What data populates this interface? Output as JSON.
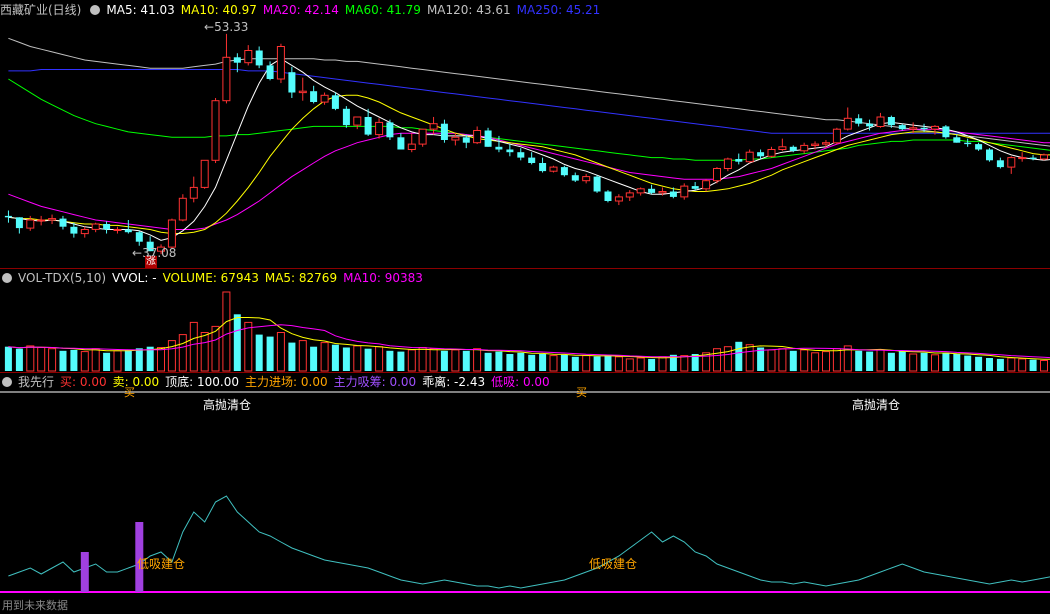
{
  "colors": {
    "up": "#ff3232",
    "down": "#54fcfc",
    "ma5": "#ffffff",
    "ma10": "#ffff00",
    "ma20": "#ff00ff",
    "ma60": "#00ff00",
    "ma120": "#c0c0c0",
    "ma250": "#3232ff",
    "grid": "#8b0000"
  },
  "price_panel": {
    "title": "西藏矿业(日线)",
    "items": [
      {
        "label": "MA5: 41.03",
        "color": "#ffffff"
      },
      {
        "label": "MA10: 40.97",
        "color": "#ffff00"
      },
      {
        "label": "MA20: 42.14",
        "color": "#ff00ff"
      },
      {
        "label": "MA60: 41.79",
        "color": "#00ff00"
      },
      {
        "label": "MA120: 43.61",
        "color": "#c0c0c0"
      },
      {
        "label": "MA250: 45.21",
        "color": "#3232ff"
      }
    ],
    "high_label": "53.33",
    "low_label": "37.08",
    "marker": "涨"
  },
  "volume_panel": {
    "title": "VOL-TDX(5,10)",
    "items": [
      {
        "label": "VVOL: -",
        "color": "#ffffff"
      },
      {
        "label": "VOLUME: 67943",
        "color": "#ffff00"
      },
      {
        "label": "MA5: 82769",
        "color": "#ffff00"
      },
      {
        "label": "MA10: 90383",
        "color": "#ff00ff"
      }
    ]
  },
  "indicator_panel": {
    "title": "我先行",
    "items": [
      {
        "label": "买: 0.00",
        "color": "#ff3232"
      },
      {
        "label": "卖: 0.00",
        "color": "#ffff00"
      },
      {
        "label": "顶底: 100.00",
        "color": "#ffffff"
      },
      {
        "label": "主力进场: 0.00",
        "color": "#ffa500"
      },
      {
        "label": "主力吸筹: 0.00",
        "color": "#a050ff"
      },
      {
        "label": "乖离: -2.43",
        "color": "#ffffff"
      },
      {
        "label": "低吸: 0.00",
        "color": "#ff00ff"
      }
    ],
    "signal_sell": "高抛清仓",
    "signal_buy": "低吸建仓",
    "buy_mark": "买",
    "watermark": "用到未来数据"
  },
  "chart_data": {
    "type": "candlestick",
    "candles": [
      [
        39.9,
        40.3,
        39.4,
        39.8
      ],
      [
        39.8,
        39.8,
        38.6,
        39.0
      ],
      [
        39.0,
        39.9,
        38.8,
        39.6
      ],
      [
        39.6,
        39.9,
        39.2,
        39.6
      ],
      [
        39.6,
        40.0,
        39.3,
        39.7
      ],
      [
        39.7,
        39.9,
        38.9,
        39.1
      ],
      [
        39.1,
        39.4,
        38.3,
        38.6
      ],
      [
        38.6,
        39.1,
        38.3,
        38.9
      ],
      [
        38.9,
        39.4,
        38.7,
        39.3
      ],
      [
        39.3,
        39.5,
        38.6,
        38.9
      ],
      [
        38.9,
        39.1,
        38.6,
        38.9
      ],
      [
        38.9,
        39.6,
        38.6,
        38.7
      ],
      [
        38.7,
        38.8,
        37.7,
        38.0
      ],
      [
        38.0,
        38.4,
        37.3,
        37.3
      ],
      [
        37.3,
        37.8,
        37.08,
        37.6
      ],
      [
        37.6,
        39.7,
        37.5,
        39.6
      ],
      [
        39.6,
        41.5,
        39.5,
        41.2
      ],
      [
        41.2,
        42.8,
        40.9,
        42.0
      ],
      [
        42.0,
        44.0,
        41.9,
        44.0
      ],
      [
        44.0,
        48.6,
        43.8,
        48.4
      ],
      [
        48.4,
        53.33,
        48.2,
        51.6
      ],
      [
        51.6,
        51.9,
        50.5,
        51.2
      ],
      [
        51.2,
        52.5,
        51.0,
        52.1
      ],
      [
        52.1,
        52.4,
        50.8,
        51.0
      ],
      [
        51.0,
        51.3,
        49.9,
        50.0
      ],
      [
        50.0,
        52.6,
        49.7,
        52.4
      ],
      [
        50.5,
        50.9,
        48.6,
        49.0
      ],
      [
        49.0,
        50.1,
        48.4,
        49.1
      ],
      [
        49.1,
        49.5,
        48.2,
        48.3
      ],
      [
        48.3,
        49.0,
        48.1,
        48.8
      ],
      [
        48.8,
        49.0,
        47.7,
        47.8
      ],
      [
        47.8,
        48.0,
        46.4,
        46.6
      ],
      [
        46.6,
        47.2,
        46.3,
        47.2
      ],
      [
        47.2,
        47.8,
        45.8,
        45.9
      ],
      [
        45.9,
        47.1,
        45.6,
        46.8
      ],
      [
        46.8,
        47.0,
        45.5,
        45.7
      ],
      [
        45.7,
        46.0,
        44.8,
        44.8
      ],
      [
        44.8,
        46.0,
        44.6,
        45.2
      ],
      [
        45.2,
        46.3,
        45.0,
        46.3
      ],
      [
        46.3,
        47.2,
        45.9,
        46.7
      ],
      [
        46.7,
        47.0,
        45.3,
        45.5
      ],
      [
        45.5,
        46.0,
        45.1,
        45.7
      ],
      [
        45.7,
        45.9,
        44.9,
        45.3
      ],
      [
        45.3,
        46.5,
        45.2,
        46.2
      ],
      [
        46.2,
        46.4,
        45.0,
        45.0
      ],
      [
        45.0,
        45.8,
        44.6,
        44.8
      ],
      [
        44.8,
        45.2,
        44.3,
        44.6
      ],
      [
        44.6,
        44.9,
        44.0,
        44.2
      ],
      [
        44.2,
        44.6,
        43.7,
        43.8
      ],
      [
        43.8,
        44.2,
        43.1,
        43.2
      ],
      [
        43.2,
        43.6,
        43.1,
        43.5
      ],
      [
        43.5,
        43.6,
        42.8,
        42.9
      ],
      [
        42.9,
        43.1,
        42.4,
        42.5
      ],
      [
        42.5,
        43.0,
        42.3,
        42.8
      ],
      [
        42.8,
        42.9,
        41.6,
        41.7
      ],
      [
        41.7,
        41.8,
        40.9,
        41.0
      ],
      [
        41.0,
        41.5,
        40.7,
        41.3
      ],
      [
        41.3,
        41.8,
        41.0,
        41.6
      ],
      [
        41.6,
        42.0,
        41.4,
        41.9
      ],
      [
        41.9,
        42.2,
        41.5,
        41.6
      ],
      [
        41.6,
        42.0,
        41.4,
        41.7
      ],
      [
        41.7,
        42.0,
        41.2,
        41.3
      ],
      [
        41.3,
        42.3,
        41.1,
        42.1
      ],
      [
        42.1,
        42.4,
        41.8,
        41.9
      ],
      [
        41.9,
        42.6,
        41.7,
        42.5
      ],
      [
        42.5,
        43.5,
        42.3,
        43.4
      ],
      [
        43.4,
        44.2,
        43.2,
        44.1
      ],
      [
        44.1,
        44.5,
        43.7,
        43.9
      ],
      [
        43.9,
        44.8,
        43.8,
        44.6
      ],
      [
        44.6,
        44.8,
        44.1,
        44.3
      ],
      [
        44.3,
        45.0,
        44.2,
        44.8
      ],
      [
        44.8,
        45.6,
        44.7,
        45.0
      ],
      [
        45.0,
        45.1,
        44.6,
        44.7
      ],
      [
        44.7,
        45.3,
        44.5,
        45.1
      ],
      [
        45.1,
        45.4,
        44.8,
        45.2
      ],
      [
        45.2,
        45.5,
        44.9,
        45.3
      ],
      [
        45.3,
        46.4,
        45.2,
        46.3
      ],
      [
        46.3,
        47.9,
        46.2,
        47.1
      ],
      [
        47.1,
        47.4,
        46.5,
        46.7
      ],
      [
        46.7,
        47.0,
        46.2,
        46.5
      ],
      [
        46.5,
        47.5,
        46.4,
        47.2
      ],
      [
        47.2,
        47.3,
        46.4,
        46.6
      ],
      [
        46.6,
        46.7,
        46.2,
        46.3
      ],
      [
        46.3,
        46.8,
        46.0,
        46.4
      ],
      [
        46.4,
        46.7,
        46.1,
        46.3
      ],
      [
        46.3,
        46.6,
        45.9,
        46.5
      ],
      [
        46.5,
        46.6,
        45.6,
        45.7
      ],
      [
        45.7,
        45.9,
        45.3,
        45.3
      ],
      [
        45.3,
        45.6,
        45.0,
        45.2
      ],
      [
        45.2,
        45.3,
        44.7,
        44.8
      ],
      [
        44.8,
        44.9,
        43.9,
        44.0
      ],
      [
        44.0,
        44.2,
        43.4,
        43.5
      ],
      [
        43.5,
        44.3,
        43.0,
        44.2
      ],
      [
        44.2,
        44.6,
        43.9,
        44.2
      ],
      [
        44.2,
        44.4,
        44.0,
        44.1
      ],
      [
        44.1,
        44.5,
        44.0,
        44.4
      ],
      [
        44.4,
        44.7,
        44.0,
        44.1
      ]
    ],
    "ma5": [
      39.8,
      39.7,
      39.6,
      39.5,
      39.6,
      39.5,
      39.3,
      39.1,
      39.0,
      38.9,
      38.9,
      38.9,
      38.8,
      38.5,
      38.1,
      38.3,
      38.8,
      39.5,
      40.6,
      42.0,
      44.0,
      46.0,
      48.0,
      49.7,
      51.0,
      51.5,
      51.0,
      50.5,
      49.9,
      49.4,
      49.0,
      48.5,
      48.0,
      47.6,
      47.2,
      46.8,
      46.4,
      46.1,
      45.9,
      45.9,
      45.8,
      45.8,
      45.8,
      45.8,
      45.6,
      45.4,
      45.2,
      45.0,
      44.7,
      44.4,
      44.1,
      43.7,
      43.4,
      43.2,
      42.9,
      42.6,
      42.3,
      42.0,
      41.7,
      41.5,
      41.5,
      41.6,
      41.7,
      41.8,
      42.0,
      42.4,
      42.9,
      43.3,
      43.8,
      44.1,
      44.4,
      44.6,
      44.7,
      44.8,
      44.9,
      45.0,
      45.4,
      45.8,
      46.1,
      46.4,
      46.7,
      46.8,
      46.7,
      46.6,
      46.5,
      46.4,
      46.3,
      46.1,
      45.8,
      45.5,
      45.1,
      44.7,
      44.4,
      44.2,
      44.1,
      44.0,
      44.1
    ],
    "ma10": [
      39.8,
      39.7,
      39.7,
      39.6,
      39.6,
      39.5,
      39.4,
      39.3,
      39.3,
      39.2,
      39.2,
      39.1,
      39.0,
      38.9,
      38.7,
      38.6,
      38.6,
      38.7,
      38.9,
      39.4,
      40.1,
      41.0,
      42.0,
      43.1,
      44.3,
      45.3,
      46.3,
      47.1,
      47.8,
      48.4,
      48.7,
      48.8,
      48.8,
      48.6,
      48.3,
      47.9,
      47.5,
      47.2,
      46.9,
      46.6,
      46.3,
      46.0,
      45.8,
      45.6,
      45.5,
      45.4,
      45.3,
      45.2,
      45.1,
      45.0,
      44.8,
      44.6,
      44.4,
      44.1,
      43.8,
      43.5,
      43.2,
      42.9,
      42.6,
      42.3,
      42.1,
      41.9,
      41.8,
      41.7,
      41.7,
      41.8,
      41.9,
      42.1,
      42.3,
      42.6,
      42.9,
      43.3,
      43.6,
      43.9,
      44.2,
      44.5,
      44.8,
      45.1,
      45.3,
      45.5,
      45.7,
      45.9,
      46.0,
      46.1,
      46.1,
      46.1,
      46.0,
      45.9,
      45.7,
      45.5,
      45.3,
      45.1,
      44.9,
      44.7,
      44.5,
      44.4,
      44.4
    ],
    "ma20": [
      41.5,
      41.2,
      40.9,
      40.6,
      40.4,
      40.2,
      40.0,
      39.8,
      39.6,
      39.5,
      39.4,
      39.3,
      39.2,
      39.1,
      39.0,
      38.9,
      38.9,
      38.9,
      39.0,
      39.3,
      39.6,
      40.0,
      40.5,
      41.0,
      41.6,
      42.2,
      42.8,
      43.3,
      43.8,
      44.3,
      44.7,
      45.0,
      45.3,
      45.5,
      45.7,
      45.9,
      46.0,
      46.0,
      46.0,
      46.0,
      46.0,
      46.0,
      45.9,
      45.8,
      45.7,
      45.5,
      45.3,
      45.1,
      44.9,
      44.7,
      44.5,
      44.3,
      44.1,
      43.9,
      43.7,
      43.5,
      43.3,
      43.1,
      43.0,
      42.9,
      42.8,
      42.7,
      42.6,
      42.6,
      42.6,
      42.6,
      42.7,
      42.8,
      43.0,
      43.2,
      43.4,
      43.7,
      44.0,
      44.3,
      44.6,
      44.9,
      45.2,
      45.4,
      45.6,
      45.8,
      46.0,
      46.1,
      46.2,
      46.3,
      46.3,
      46.3,
      46.2,
      46.1,
      46.0,
      45.9,
      45.8,
      45.7,
      45.6,
      45.5,
      45.4,
      45.3,
      45.3
    ],
    "ma60": [
      50.0,
      49.5,
      49.0,
      48.5,
      48.1,
      47.7,
      47.3,
      47.0,
      46.7,
      46.5,
      46.3,
      46.1,
      46.0,
      45.9,
      45.8,
      45.7,
      45.7,
      45.7,
      45.7,
      45.8,
      45.8,
      45.9,
      45.9,
      46.0,
      46.1,
      46.2,
      46.3,
      46.4,
      46.5,
      46.5,
      46.5,
      46.5,
      46.5,
      46.5,
      46.5,
      46.5,
      46.4,
      46.4,
      46.3,
      46.2,
      46.1,
      46.0,
      45.9,
      45.8,
      45.7,
      45.6,
      45.5,
      45.4,
      45.3,
      45.2,
      45.1,
      45.0,
      44.9,
      44.8,
      44.7,
      44.6,
      44.5,
      44.4,
      44.3,
      44.2,
      44.2,
      44.1,
      44.1,
      44.0,
      44.0,
      44.0,
      44.0,
      44.0,
      44.1,
      44.1,
      44.2,
      44.3,
      44.4,
      44.5,
      44.6,
      44.7,
      44.8,
      44.9,
      45.1,
      45.2,
      45.3,
      45.4,
      45.4,
      45.5,
      45.5,
      45.5,
      45.5,
      45.5,
      45.4,
      45.4,
      45.3,
      45.2,
      45.1,
      45.0,
      44.9,
      44.8,
      44.7
    ],
    "ma120": [
      53.0,
      52.7,
      52.4,
      52.2,
      52.0,
      51.8,
      51.6,
      51.4,
      51.3,
      51.2,
      51.1,
      51.0,
      50.9,
      50.8,
      50.8,
      50.8,
      50.8,
      50.9,
      51.0,
      51.1,
      51.3,
      51.4,
      51.5,
      51.5,
      51.5,
      51.5,
      51.5,
      51.5,
      51.5,
      51.4,
      51.4,
      51.3,
      51.3,
      51.2,
      51.1,
      51.0,
      50.9,
      50.8,
      50.7,
      50.6,
      50.5,
      50.4,
      50.3,
      50.2,
      50.1,
      50.0,
      49.9,
      49.8,
      49.7,
      49.6,
      49.5,
      49.4,
      49.3,
      49.2,
      49.1,
      49.0,
      48.9,
      48.8,
      48.7,
      48.6,
      48.5,
      48.4,
      48.3,
      48.2,
      48.1,
      48.0,
      47.9,
      47.8,
      47.7,
      47.6,
      47.5,
      47.4,
      47.3,
      47.2,
      47.1,
      47.0,
      47.0,
      46.9,
      46.8,
      46.7,
      46.6,
      46.5,
      46.4,
      46.3,
      46.2,
      46.1,
      46.0,
      45.9,
      45.8,
      45.7,
      45.6,
      45.5,
      45.4,
      45.3,
      45.2,
      45.1,
      45.0
    ],
    "ma250": [
      50.6,
      50.6,
      50.6,
      50.7,
      50.7,
      50.7,
      50.7,
      50.7,
      50.7,
      50.7,
      50.7,
      50.7,
      50.7,
      50.7,
      50.7,
      50.7,
      50.7,
      50.7,
      50.7,
      50.7,
      50.7,
      50.7,
      50.6,
      50.6,
      50.6,
      50.5,
      50.4,
      50.3,
      50.2,
      50.1,
      50.0,
      49.9,
      49.8,
      49.7,
      49.6,
      49.5,
      49.4,
      49.3,
      49.2,
      49.1,
      49.0,
      48.9,
      48.8,
      48.7,
      48.6,
      48.5,
      48.4,
      48.3,
      48.2,
      48.1,
      48.0,
      47.9,
      47.8,
      47.7,
      47.6,
      47.5,
      47.4,
      47.3,
      47.2,
      47.1,
      47.0,
      46.9,
      46.8,
      46.7,
      46.6,
      46.5,
      46.4,
      46.3,
      46.2,
      46.1,
      46.0,
      46.0,
      46.0,
      46.0,
      46.0,
      46.0,
      46.0,
      46.0,
      46.0,
      46.0,
      46.0,
      46.0,
      46.0,
      46.0,
      46.0,
      46.0,
      46.0,
      46.0,
      46.0,
      46.0,
      46.0,
      46.0,
      46.0,
      46.0,
      46.0,
      46.0,
      46.0
    ],
    "price_range": [
      36.5,
      54.5
    ],
    "volume": [
      60,
      55,
      62,
      58,
      55,
      50,
      52,
      48,
      55,
      45,
      50,
      52,
      56,
      60,
      58,
      75,
      90,
      120,
      95,
      110,
      195,
      140,
      120,
      90,
      85,
      95,
      70,
      75,
      60,
      70,
      65,
      58,
      62,
      55,
      60,
      50,
      48,
      52,
      58,
      55,
      50,
      52,
      50,
      55,
      45,
      48,
      42,
      45,
      40,
      42,
      38,
      40,
      35,
      38,
      36,
      40,
      35,
      30,
      32,
      30,
      35,
      40,
      38,
      42,
      45,
      55,
      60,
      72,
      65,
      58,
      52,
      55,
      50,
      52,
      45,
      48,
      55,
      62,
      50,
      48,
      52,
      45,
      50,
      42,
      45,
      40,
      45,
      42,
      38,
      35,
      32,
      30,
      32,
      30,
      28,
      26,
      28
    ],
    "volume_range": [
      0,
      200
    ],
    "indicator": {
      "bias": [
        8,
        10,
        12,
        9,
        12,
        15,
        10,
        12,
        14,
        10,
        10,
        12,
        14,
        18,
        20,
        15,
        30,
        40,
        35,
        45,
        48,
        40,
        35,
        30,
        28,
        25,
        22,
        20,
        18,
        16,
        15,
        14,
        13,
        12,
        10,
        8,
        6,
        5,
        4,
        5,
        6,
        5,
        4,
        3,
        3,
        2,
        3,
        2,
        3,
        4,
        5,
        6,
        8,
        10,
        12,
        15,
        18,
        22,
        26,
        30,
        25,
        28,
        25,
        20,
        18,
        14,
        12,
        10,
        8,
        6,
        5,
        5,
        4,
        5,
        4,
        3,
        4,
        5,
        6,
        8,
        10,
        12,
        14,
        12,
        10,
        9,
        8,
        7,
        6,
        5,
        4,
        5,
        6,
        5,
        6,
        7,
        8
      ],
      "accumulation": [
        0,
        0,
        0,
        0,
        0,
        0,
        0,
        20,
        0,
        0,
        0,
        0,
        35,
        0,
        0,
        0,
        0,
        0,
        0,
        0,
        0,
        0,
        0,
        0,
        0,
        0,
        0,
        0,
        0,
        0,
        0,
        0,
        0,
        0,
        0,
        0,
        0,
        0,
        0,
        0,
        0,
        0,
        0,
        0,
        0,
        0,
        0,
        0,
        0,
        0,
        0,
        0,
        0,
        0,
        0,
        0,
        0,
        0,
        0,
        0,
        0,
        0,
        0,
        0,
        0,
        0,
        0,
        0,
        0,
        0,
        0,
        0,
        0,
        0,
        0,
        0,
        0,
        0,
        0,
        0,
        0,
        0,
        0,
        0,
        0,
        0,
        0,
        0,
        0,
        0,
        0,
        0,
        0,
        0,
        0,
        0,
        0
      ],
      "range": [
        0,
        100
      ]
    }
  }
}
